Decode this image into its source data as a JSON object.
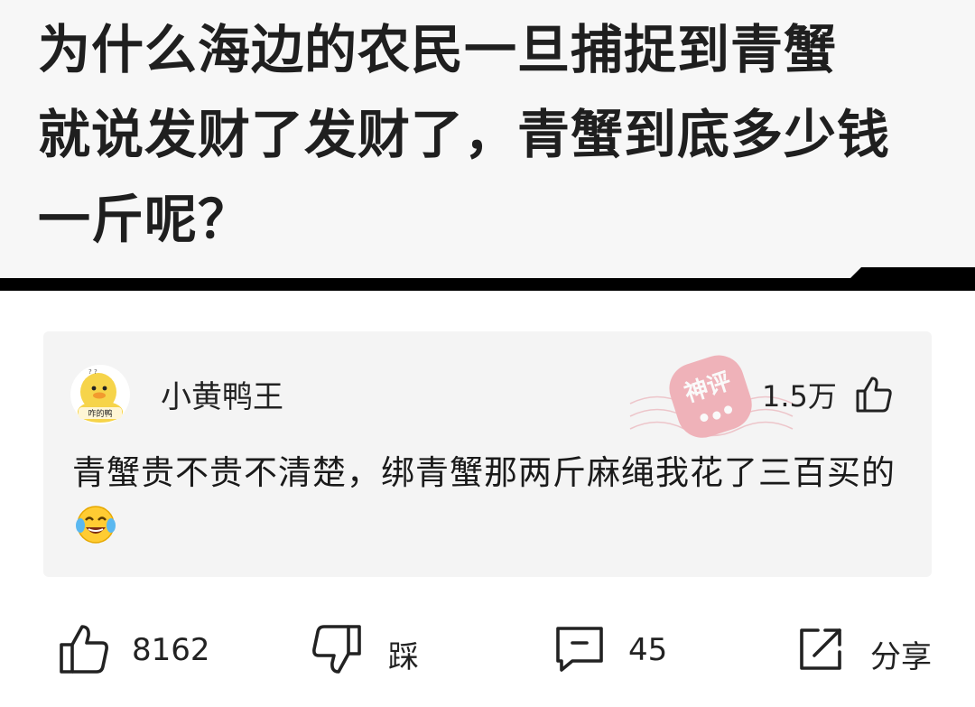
{
  "question": {
    "title_lines": [
      "为什么海边的农民一旦捕捉到青蟹",
      "就说发财了发财了，青蟹到底多少钱",
      "一斤呢？"
    ]
  },
  "comment": {
    "username": "小黄鸭王",
    "avatar_text": "咋的鸭",
    "stamp_text": "神评",
    "like_count": "1.5万",
    "body": "青蟹贵不贵不清楚，绑青蟹那两斤麻绳我花了三百买的",
    "emoji": "crying-laughing-emoji"
  },
  "actions": {
    "like_count": "8162",
    "dislike_label": "踩",
    "comment_count": "45",
    "share_label": "分享"
  },
  "colors": {
    "question_bg": "#f7f7f7",
    "card_bg": "#f4f4f4",
    "stamp": "#e8808a",
    "divider": "#000000"
  }
}
